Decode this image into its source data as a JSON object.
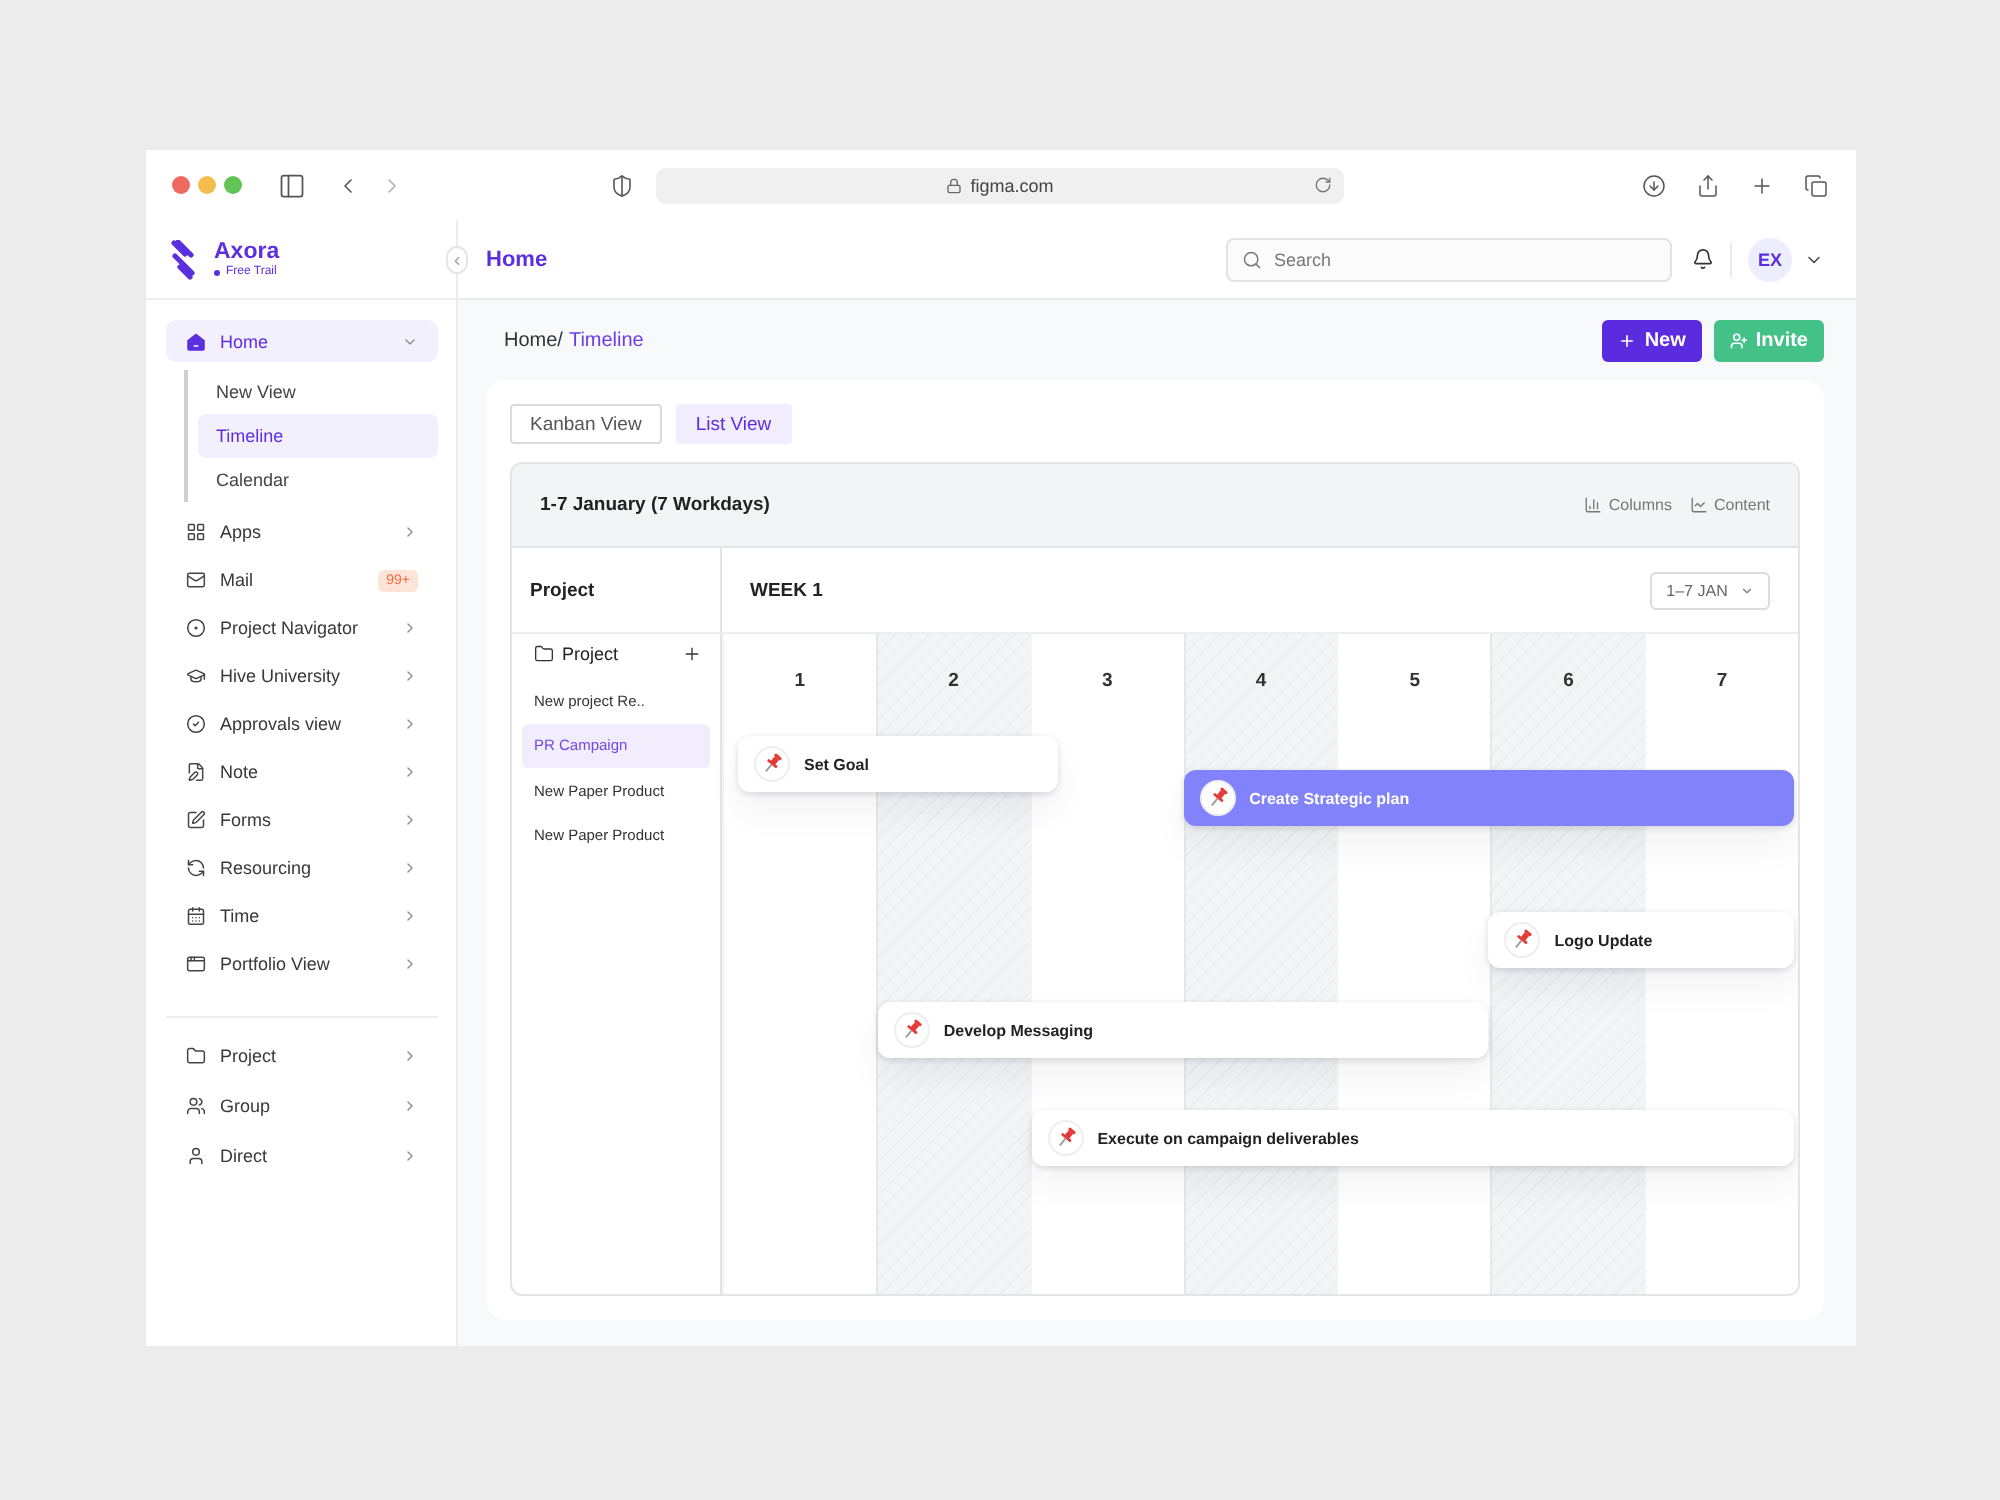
{
  "browser": {
    "url": "figma.com"
  },
  "sidebar": {
    "brand": {
      "name": "Axora",
      "plan": "Free Trail"
    },
    "nav": [
      {
        "label": "Home",
        "selected": true,
        "expanded": true,
        "children": [
          {
            "label": "New View",
            "selected": false
          },
          {
            "label": "Timeline",
            "selected": true
          },
          {
            "label": "Calendar",
            "selected": false
          }
        ]
      },
      {
        "label": "Apps",
        "selected": false,
        "expanded": false
      },
      {
        "label": "Mail",
        "selected": false,
        "badge": "99+"
      },
      {
        "label": "Project Navigator",
        "selected": false,
        "expanded": false
      },
      {
        "label": "Hive University",
        "selected": false,
        "expanded": false
      },
      {
        "label": "Approvals view",
        "selected": false,
        "expanded": false
      },
      {
        "label": "Note",
        "selected": false,
        "expanded": false
      },
      {
        "label": "Forms",
        "selected": false,
        "expanded": false
      },
      {
        "label": "Resourcing",
        "selected": false,
        "expanded": false
      },
      {
        "label": "Time",
        "selected": false,
        "expanded": false
      },
      {
        "label": "Portfolio View",
        "selected": false,
        "expanded": false
      }
    ],
    "groups": [
      {
        "label": "Project",
        "expanded": false
      },
      {
        "label": "Group",
        "expanded": false
      },
      {
        "label": "Direct",
        "expanded": false
      }
    ]
  },
  "header": {
    "title": "Home",
    "search": {
      "placeholder": "Search"
    },
    "avatar": "EX"
  },
  "breadcrumb": [
    {
      "label": "Home/",
      "current": false
    },
    {
      "label": "Timeline",
      "current": true
    }
  ],
  "actions": [
    {
      "label": "New",
      "kind": "primary"
    },
    {
      "label": "Invite",
      "kind": "success"
    }
  ],
  "tabs": [
    {
      "label": "Kanban View",
      "selected": false
    },
    {
      "label": "List View",
      "selected": true
    }
  ],
  "timeline": {
    "title": "1-7 January (7 Workdays)",
    "tools": [
      "Columns",
      "Content"
    ],
    "project_column": "Project",
    "week": "WEEK 1",
    "range": "1–7 JAN",
    "projects": {
      "header": "Project",
      "items": [
        {
          "label": "New project Re..",
          "selected": false
        },
        {
          "label": "PR Campaign",
          "selected": true
        },
        {
          "label": "New Paper Product",
          "selected": false
        },
        {
          "label": "New Paper Product",
          "selected": false
        }
      ]
    },
    "days": [
      {
        "label": "1",
        "shaded": false
      },
      {
        "label": "2",
        "shaded": true
      },
      {
        "label": "3",
        "shaded": false
      },
      {
        "label": "4",
        "shaded": true
      },
      {
        "label": "5",
        "shaded": false
      },
      {
        "label": "6",
        "shaded": true
      },
      {
        "label": "7",
        "shaded": false
      }
    ],
    "events": [
      {
        "title": "Set Goal",
        "selected": false
      },
      {
        "title": "Create Strategic plan",
        "selected": true
      },
      {
        "title": "Logo Update",
        "selected": false
      },
      {
        "title": "Develop Messaging",
        "selected": false
      },
      {
        "title": "Execute on campaign deliverables",
        "selected": false
      }
    ]
  }
}
